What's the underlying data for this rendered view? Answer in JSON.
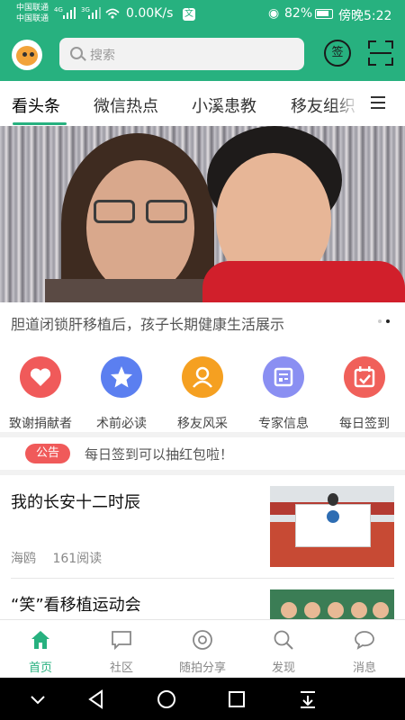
{
  "status_bar": {
    "carrier1": "中国联通",
    "carrier2": "中国联通",
    "net1": "4G",
    "net2": "3G",
    "speed": "0.00K/s",
    "vpn": "文",
    "battery": "82%",
    "time": "傍晚5:22",
    "theme_color": "#27b17f"
  },
  "header": {
    "search_placeholder": "搜索",
    "sign_label": "签"
  },
  "tabs": [
    {
      "label": "看头条",
      "active": true
    },
    {
      "label": "微信热点",
      "active": false
    },
    {
      "label": "小溪患教",
      "active": false
    },
    {
      "label": "移友组织",
      "active": false
    }
  ],
  "banner": {
    "caption": "胆道闭锁肝移植后，孩子长期健康生活展示"
  },
  "quick_links": [
    {
      "label": "致谢捐献者",
      "icon": "heart-icon",
      "color": "#f05a5a"
    },
    {
      "label": "术前必读",
      "icon": "star-icon",
      "color": "#5b7ff0"
    },
    {
      "label": "移友风采",
      "icon": "person-icon",
      "color": "#f5a021"
    },
    {
      "label": "专家信息",
      "icon": "document-icon",
      "color": "#8a8ff2"
    },
    {
      "label": "每日签到",
      "icon": "calendar-check-icon",
      "color": "#f0605a"
    }
  ],
  "announcement": {
    "badge": "公告",
    "text": "每日签到可以抽红包啦！"
  },
  "articles": [
    {
      "title": "我的长安十二时辰",
      "author": "海鸥",
      "reads": "161阅读"
    },
    {
      "title": "“笑”看移植运动会",
      "author": "",
      "reads": ""
    }
  ],
  "bottom_nav": [
    {
      "label": "首页",
      "icon": "home-icon",
      "active": true
    },
    {
      "label": "社区",
      "icon": "chat-bubble-icon",
      "active": false
    },
    {
      "label": "随拍分享",
      "icon": "camera-icon",
      "active": false
    },
    {
      "label": "发现",
      "icon": "search-icon",
      "active": false
    },
    {
      "label": "消息",
      "icon": "message-icon",
      "active": false
    }
  ]
}
